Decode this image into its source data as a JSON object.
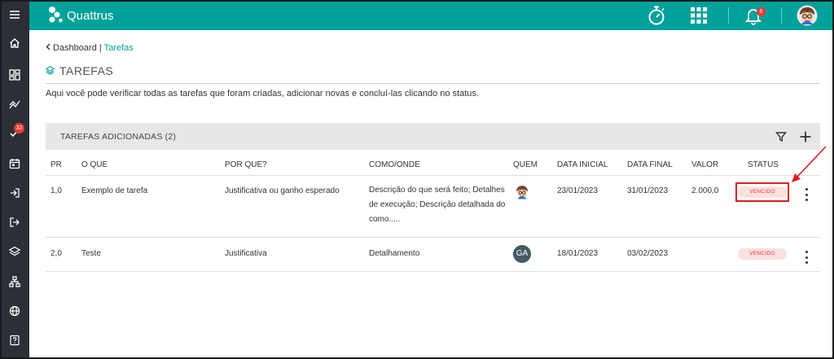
{
  "app": {
    "brand": "Quattrus",
    "notifications": "6",
    "tasks_badge": "32"
  },
  "breadcrumb": {
    "parent": "Dashboard",
    "separator": "|",
    "current": "Tarefas"
  },
  "page": {
    "title": "TAREFAS",
    "description": "Aqui você pode verificar todas as tarefas que foram criadas, adicionar novas e concluí-las clicando no status."
  },
  "card": {
    "title": "TAREFAS ADICIONADAS (2)"
  },
  "table": {
    "headers": {
      "pr": "PR",
      "oque": "O QUE",
      "porque": "POR QUE?",
      "como": "COMO/ONDE",
      "quem": "QUEM",
      "data_inicial": "DATA INICIAL",
      "data_final": "DATA FINAL",
      "valor": "VALOR",
      "status": "STATUS"
    },
    "rows": [
      {
        "pr": "1,0",
        "oque": "Exemplo de tarefa",
        "porque": "Justificativa ou ganho esperado",
        "como": "Descrição do que será feito; Detalhes de execução; Descrição detalhada do como.....",
        "quem": "",
        "data_inicial": "23/01/2023",
        "data_final": "31/01/2023",
        "valor": "2.000,0",
        "status": "VENCIDO"
      },
      {
        "pr": "2,0",
        "oque": "Teste",
        "porque": "Justificativa",
        "como": "Detalhamento",
        "quem": "GA",
        "data_inicial": "18/01/2023",
        "data_final": "03/02/2023",
        "valor": "",
        "status": "VENCIDO"
      }
    ]
  },
  "colors": {
    "accent": "#00a19a",
    "sidebar": "#2b2f36",
    "danger": "#e53935",
    "status_bg": "#fde0e0"
  },
  "icons": {
    "sidebar": [
      "menu-icon",
      "home-icon",
      "dashboard-icon",
      "trend-icon",
      "tasks-icon",
      "calendar-icon",
      "login-icon",
      "logout-icon",
      "layers-icon",
      "org-chart-icon",
      "globe-icon",
      "help-icon"
    ],
    "topbar": [
      "stopwatch-icon",
      "apps-grid-icon",
      "bell-icon",
      "avatar"
    ]
  }
}
